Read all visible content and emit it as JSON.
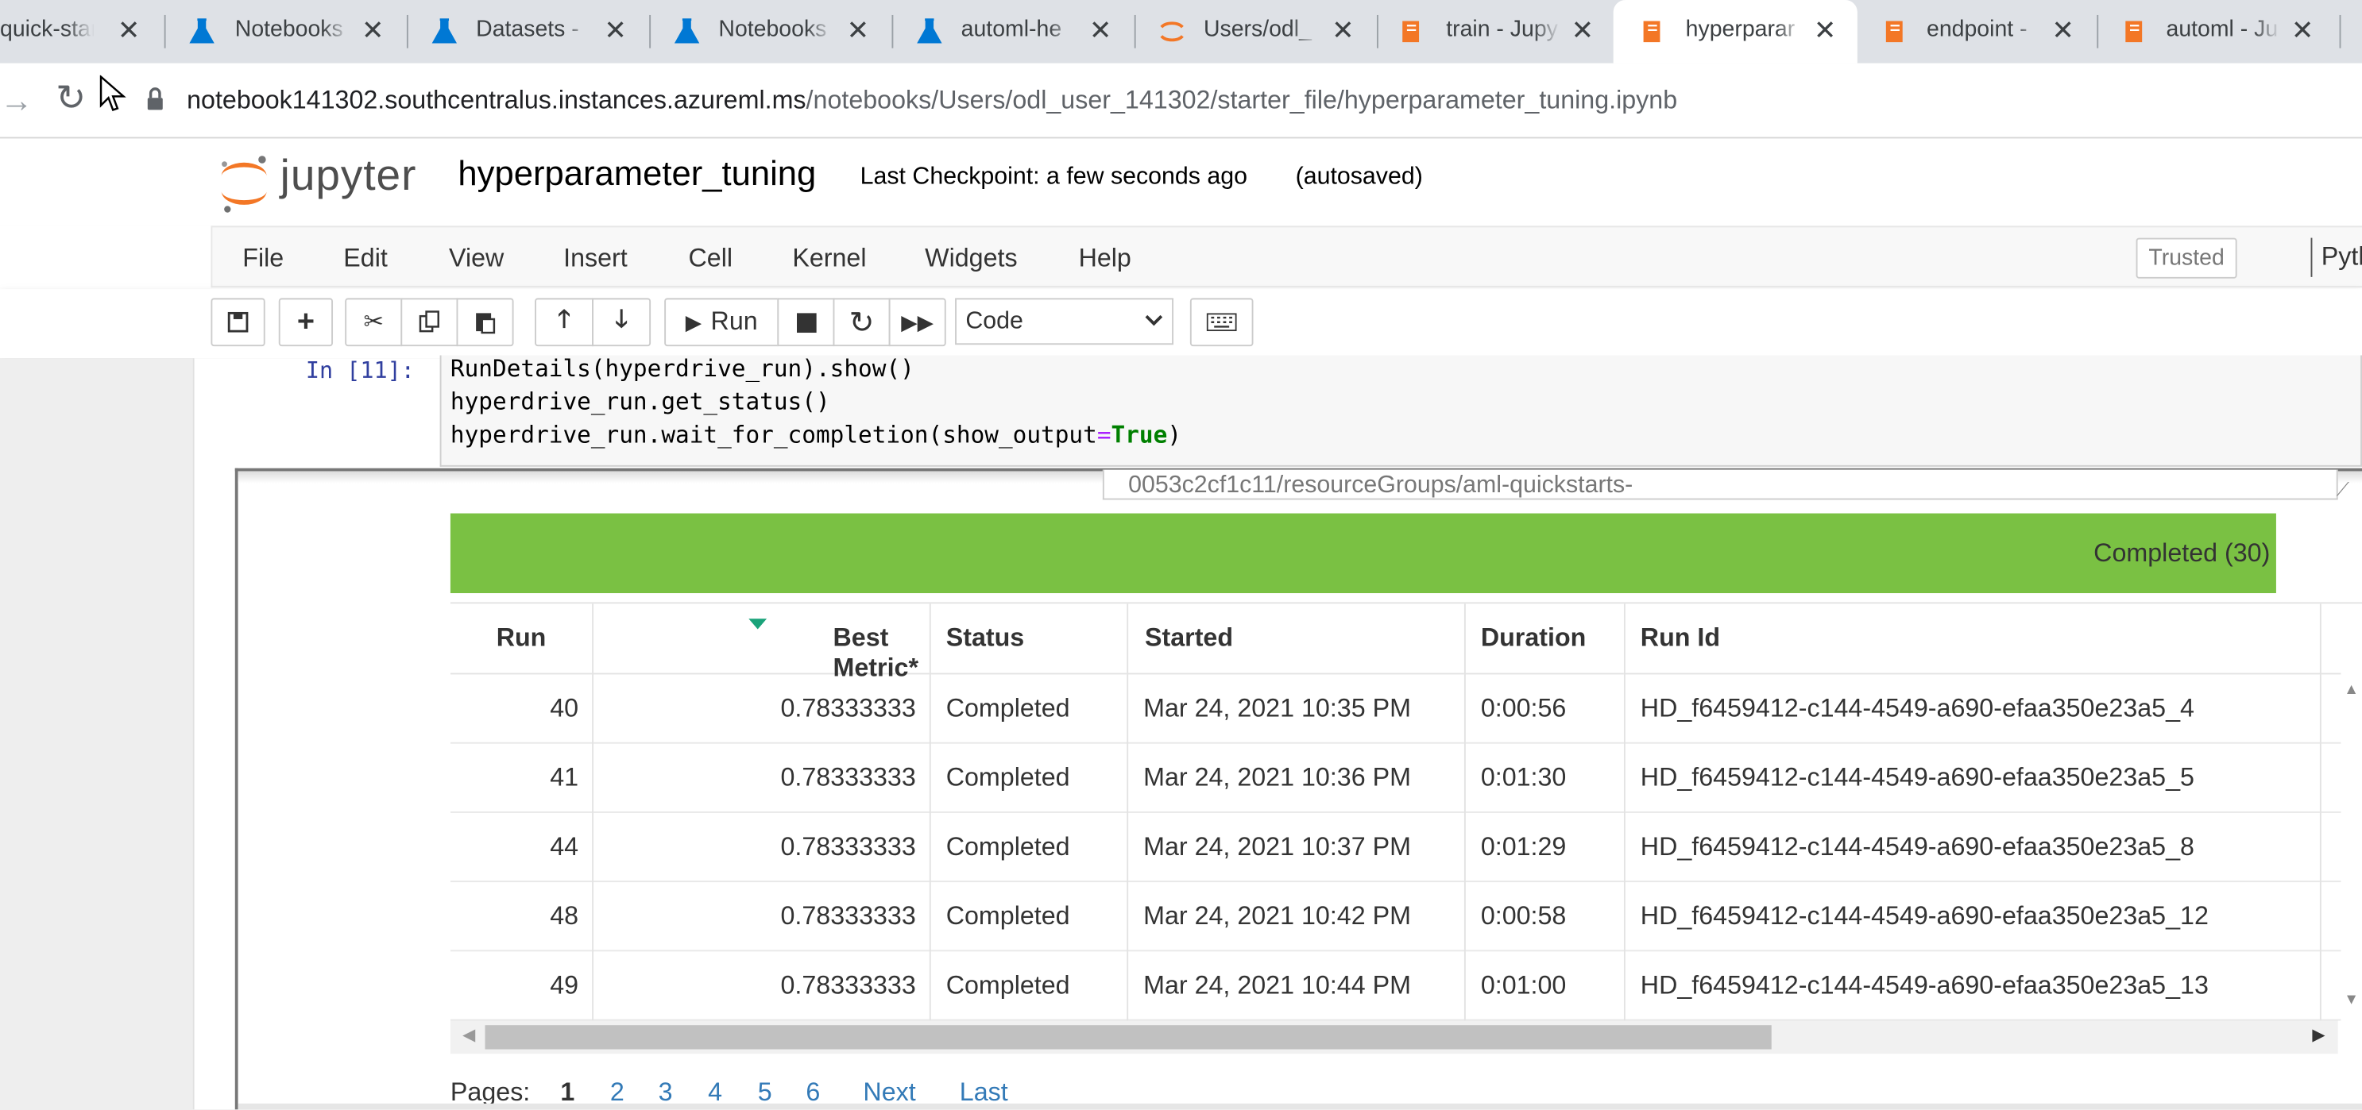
{
  "browser": {
    "tabs": [
      {
        "title": "quick-start",
        "icon": "flask-icon"
      },
      {
        "title": "Notebooks",
        "icon": "flask-icon"
      },
      {
        "title": "Datasets -",
        "icon": "flask-icon"
      },
      {
        "title": "Notebooks",
        "icon": "flask-icon"
      },
      {
        "title": "automl-he",
        "icon": "flask-icon"
      },
      {
        "title": "Users/odl_",
        "icon": "jupyter-logo-icon"
      },
      {
        "title": "train - Jupy",
        "icon": "notebook-icon"
      },
      {
        "title": "hyperparar",
        "icon": "notebook-icon",
        "active": true
      },
      {
        "title": "endpoint -",
        "icon": "notebook-icon"
      },
      {
        "title": "automl - Ju",
        "icon": "notebook-icon"
      }
    ],
    "url_host": "notebook141302.southcentralus.instances.azureml.ms",
    "url_path": "/notebooks/Users/odl_user_141302/starter_file/hyperparameter_tuning.ipynb"
  },
  "jupyter": {
    "logo_text": "jupyter",
    "notebook_name": "hyperparameter_tuning",
    "checkpoint": "Last Checkpoint: a few seconds ago",
    "autosave": "(autosaved)",
    "menu": [
      "File",
      "Edit",
      "View",
      "Insert",
      "Cell",
      "Kernel",
      "Widgets",
      "Help"
    ],
    "trusted": "Trusted",
    "kernel": "Pytho",
    "toolbar": {
      "run_label": "Run",
      "cell_type": "Code"
    }
  },
  "cell": {
    "prompt": "In [11]:",
    "lines": [
      "RunDetails(hyperdrive_run).show()",
      "hyperdrive_run.get_status()",
      "hyperdrive_run.wait_for_completion(show_output=True)"
    ],
    "line3_prefix": "hyperdrive_run.wait_for_completion(show_output",
    "line3_op": "=",
    "line3_kw": "True",
    "line3_suffix": ")"
  },
  "output": {
    "resource_text": "0053c2cf1c11/resourceGroups/aml-quickstarts-",
    "progress_label": "Completed (30)",
    "progress_fraction": 1.0,
    "progress_color": "#7ac143",
    "table": {
      "columns": [
        "Run",
        "Best Metric*",
        "Status",
        "Started",
        "Duration",
        "Run Id"
      ],
      "rows": [
        {
          "run": "40",
          "metric": "0.78333333",
          "status": "Completed",
          "started": "Mar 24, 2021 10:35 PM",
          "duration": "0:00:56",
          "run_id": "HD_f6459412-c144-4549-a690-efaa350e23a5_4"
        },
        {
          "run": "41",
          "metric": "0.78333333",
          "status": "Completed",
          "started": "Mar 24, 2021 10:36 PM",
          "duration": "0:01:30",
          "run_id": "HD_f6459412-c144-4549-a690-efaa350e23a5_5"
        },
        {
          "run": "44",
          "metric": "0.78333333",
          "status": "Completed",
          "started": "Mar 24, 2021 10:37 PM",
          "duration": "0:01:29",
          "run_id": "HD_f6459412-c144-4549-a690-efaa350e23a5_8"
        },
        {
          "run": "48",
          "metric": "0.78333333",
          "status": "Completed",
          "started": "Mar 24, 2021 10:42 PM",
          "duration": "0:00:58",
          "run_id": "HD_f6459412-c144-4549-a690-efaa350e23a5_12"
        },
        {
          "run": "49",
          "metric": "0.78333333",
          "status": "Completed",
          "started": "Mar 24, 2021 10:44 PM",
          "duration": "0:01:00",
          "run_id": "HD_f6459412-c144-4549-a690-efaa350e23a5_13"
        }
      ]
    },
    "pager": {
      "label": "Pages:",
      "pages": [
        "1",
        "2",
        "3",
        "4",
        "5",
        "6"
      ],
      "current": "1",
      "next": "Next",
      "last": "Last"
    }
  }
}
